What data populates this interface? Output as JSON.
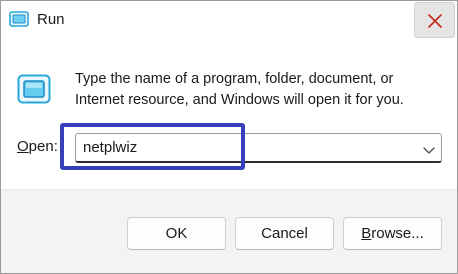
{
  "window": {
    "title": "Run",
    "title_icon": "run-app-icon",
    "close_icon": "close-icon"
  },
  "prompt": {
    "icon": "run-app-icon",
    "description": "Type the name of a program, folder, document, or Internet resource, and Windows will open it for you."
  },
  "open_field": {
    "label_mnemonic": "O",
    "label_rest": "pen:",
    "value": "netplwiz",
    "dropdown_icon": "chevron-down-icon"
  },
  "buttons": {
    "ok_label": "OK",
    "cancel_label": "Cancel",
    "browse_mnemonic": "B",
    "browse_rest": "rowse..."
  },
  "colors": {
    "close_button_bg": "#e5e5e5",
    "close_glyph": "#c42b1c",
    "highlight_box": "#3640b8",
    "icon_accent": "#2aa7d8",
    "footer_bg": "#f3f3f3"
  }
}
